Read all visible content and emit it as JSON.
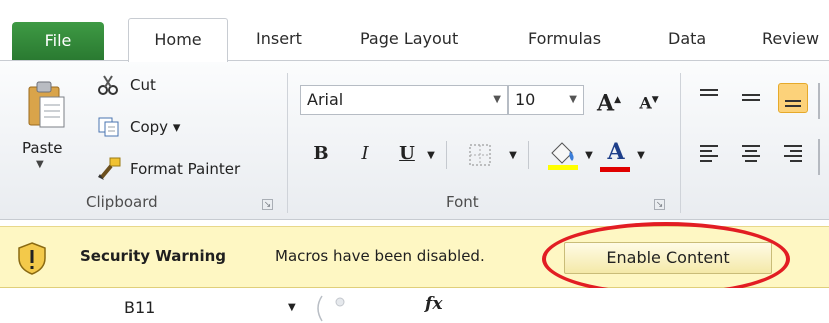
{
  "tabs": [
    {
      "label": "File"
    },
    {
      "label": "Home"
    },
    {
      "label": "Insert"
    },
    {
      "label": "Page Layout"
    },
    {
      "label": "Formulas"
    },
    {
      "label": "Data"
    },
    {
      "label": "Review"
    }
  ],
  "clipboard": {
    "paste_label": "Paste",
    "cut_label": "Cut",
    "copy_label": "Copy ▾",
    "format_painter_label": "Format Painter",
    "group_label": "Clipboard"
  },
  "font": {
    "font_name": "Arial",
    "font_size": "10",
    "group_label": "Font",
    "bold": "B",
    "italic": "I",
    "underline": "U",
    "grow": "A",
    "shrink": "A"
  },
  "security": {
    "title": "Security Warning",
    "message": "Macros have been disabled.",
    "enable_label": "Enable Content"
  },
  "formula_bar": {
    "cell_ref": "B11",
    "fx": "fx"
  },
  "colors": {
    "file_tab": "#2a7a31",
    "security_bar": "#fef7c3",
    "highlight_ellipse": "#e21d23",
    "fill_color": "#ffff00",
    "font_color": "#e00000"
  }
}
